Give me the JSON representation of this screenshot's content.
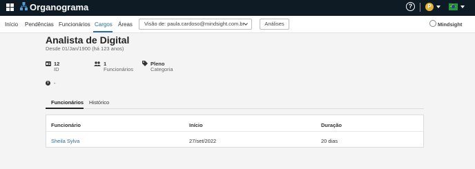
{
  "topbar": {
    "app_title": "Organograma",
    "help_glyph": "?",
    "avatar_initial": "P",
    "flag": "brazil-flag"
  },
  "nav": {
    "items": [
      {
        "label": "Início"
      },
      {
        "label": "Pendências"
      },
      {
        "label": "Funcionários"
      },
      {
        "label": "Cargos",
        "active": true
      },
      {
        "label": "Áreas"
      }
    ],
    "view_select": "Visão de: paula.cardoso@mindsight.com.br",
    "analises_button": "Análises",
    "logo_text": "Mindsight"
  },
  "position": {
    "title": "Analista de Digital",
    "since": "Desde 01/Jan/1900 (há 123 anos)",
    "stats": [
      {
        "icon": "id-card-icon",
        "value": "12",
        "label": "ID"
      },
      {
        "icon": "people-icon",
        "value": "1",
        "label": "Funcionários"
      },
      {
        "icon": "tag-icon",
        "value": "Pleno",
        "label": "Categoria"
      }
    ],
    "info_text": "-"
  },
  "tabs": [
    {
      "label": "Funcionários",
      "active": true
    },
    {
      "label": "Histórico"
    }
  ],
  "table": {
    "headers": [
      "Funcionário",
      "Início",
      "Duração"
    ],
    "rows": [
      [
        "Sheila Sylva",
        "27/set/2022",
        "20 dias"
      ]
    ]
  },
  "colors": {
    "topbar": "#0f1b24",
    "accent": "#2a6ea8",
    "avatar": "#e8b130"
  }
}
